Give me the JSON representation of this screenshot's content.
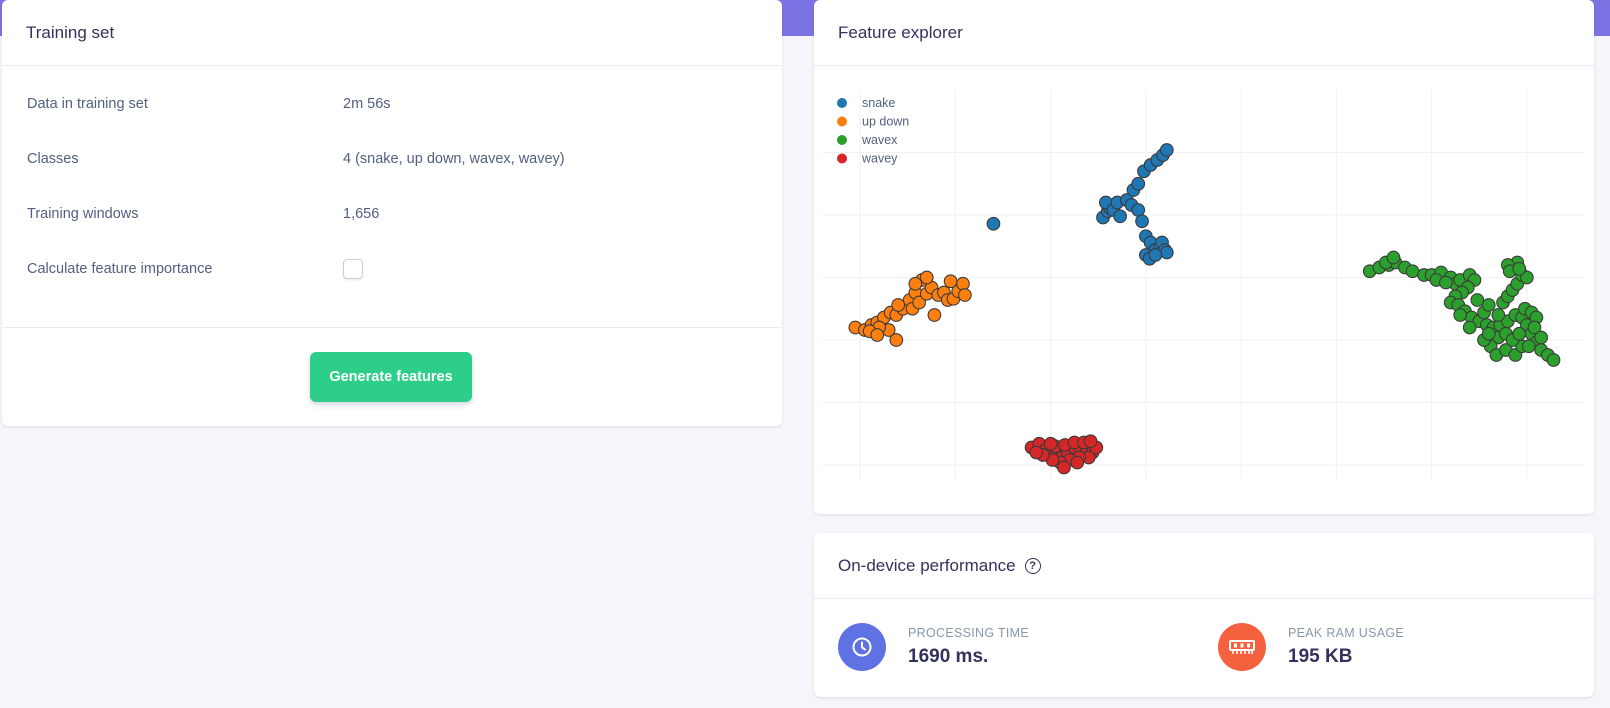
{
  "training_set": {
    "title": "Training set",
    "rows": [
      {
        "label": "Data in training set",
        "value": "2m 56s"
      },
      {
        "label": "Classes",
        "value": "4 (snake, up down, wavex, wavey)"
      },
      {
        "label": "Training windows",
        "value": "1,656"
      },
      {
        "label": "Calculate feature importance",
        "checked": false
      }
    ],
    "generate_button": "Generate features"
  },
  "feature_explorer": {
    "title": "Feature explorer",
    "chart_data": {
      "type": "scatter",
      "title": "",
      "xlabel": "",
      "ylabel": "",
      "legend_position": "top-left",
      "grid": true,
      "series": [
        {
          "name": "snake",
          "color": "#1f77b4",
          "points": [
            [
              1.4,
              0.57
            ],
            [
              2.55,
              0.52
            ],
            [
              2.6,
              0.47
            ],
            [
              2.62,
              0.44
            ],
            [
              2.58,
              0.4
            ],
            [
              2.66,
              0.46
            ],
            [
              2.7,
              0.4
            ],
            [
              2.73,
              0.51
            ],
            [
              2.8,
              0.38
            ],
            [
              2.85,
              0.42
            ],
            [
              2.87,
              0.3
            ],
            [
              2.92,
              0.25
            ],
            [
              2.98,
              0.15
            ],
            [
              3.05,
              0.1
            ],
            [
              3.12,
              0.06
            ],
            [
              3.18,
              0.02
            ],
            [
              3.22,
              -0.02
            ],
            [
              2.92,
              0.46
            ],
            [
              2.96,
              0.55
            ],
            [
              3.0,
              0.67
            ],
            [
              3.05,
              0.72
            ],
            [
              3.1,
              0.78
            ],
            [
              3.15,
              0.76
            ],
            [
              3.17,
              0.72
            ],
            [
              3.2,
              0.78
            ],
            [
              3.22,
              0.8
            ],
            [
              3.0,
              0.82
            ],
            [
              3.04,
              0.85
            ],
            [
              3.1,
              0.82
            ]
          ]
        },
        {
          "name": "up down",
          "color": "#ff7f0e",
          "points": [
            [
              -0.05,
              1.4
            ],
            [
              0.05,
              1.42
            ],
            [
              0.12,
              1.38
            ],
            [
              0.18,
              1.36
            ],
            [
              0.25,
              1.32
            ],
            [
              0.32,
              1.28
            ],
            [
              0.38,
              1.3
            ],
            [
              0.45,
              1.25
            ],
            [
              0.52,
              1.18
            ],
            [
              0.58,
              1.12
            ],
            [
              0.55,
              1.25
            ],
            [
              0.62,
              1.2
            ],
            [
              0.7,
              1.13
            ],
            [
              0.75,
              1.08
            ],
            [
              0.82,
              1.14
            ],
            [
              0.88,
              1.12
            ],
            [
              0.92,
              1.18
            ],
            [
              0.98,
              1.17
            ],
            [
              1.03,
              1.11
            ],
            [
              1.08,
              1.05
            ],
            [
              1.1,
              1.14
            ],
            [
              0.65,
              1.02
            ],
            [
              0.7,
              1.0
            ],
            [
              0.58,
              1.05
            ],
            [
              0.4,
              1.22
            ],
            [
              0.3,
              1.42
            ],
            [
              0.2,
              1.4
            ],
            [
              0.1,
              1.43
            ],
            [
              0.38,
              1.5
            ],
            [
              0.18,
              1.46
            ],
            [
              0.78,
              1.3
            ],
            [
              0.95,
              1.03
            ]
          ]
        },
        {
          "name": "wavex",
          "color": "#2ca02c",
          "points": [
            [
              5.35,
              0.95
            ],
            [
              5.45,
              0.92
            ],
            [
              5.55,
              0.9
            ],
            [
              5.62,
              0.88
            ],
            [
              5.72,
              0.92
            ],
            [
              5.8,
              0.95
            ],
            [
              5.92,
              0.98
            ],
            [
              6.0,
              0.98
            ],
            [
              6.1,
              0.96
            ],
            [
              6.2,
              1.0
            ],
            [
              6.25,
              1.05
            ],
            [
              6.3,
              1.02
            ],
            [
              6.4,
              0.98
            ],
            [
              6.45,
              1.02
            ],
            [
              6.38,
              1.08
            ],
            [
              6.32,
              1.12
            ],
            [
              6.25,
              1.15
            ],
            [
              6.2,
              1.2
            ],
            [
              6.28,
              1.22
            ],
            [
              6.35,
              1.27
            ],
            [
              6.42,
              1.32
            ],
            [
              6.5,
              1.35
            ],
            [
              6.58,
              1.38
            ],
            [
              6.65,
              1.4
            ],
            [
              6.72,
              1.38
            ],
            [
              6.8,
              1.35
            ],
            [
              6.88,
              1.3
            ],
            [
              6.95,
              1.32
            ],
            [
              7.0,
              1.38
            ],
            [
              7.05,
              1.45
            ],
            [
              7.1,
              1.52
            ],
            [
              7.15,
              1.58
            ],
            [
              7.22,
              1.62
            ],
            [
              7.28,
              1.66
            ],
            [
              6.75,
              1.2
            ],
            [
              6.8,
              1.15
            ],
            [
              6.85,
              1.1
            ],
            [
              6.9,
              1.05
            ],
            [
              6.95,
              0.98
            ],
            [
              7.0,
              1.0
            ],
            [
              6.85,
              0.92
            ],
            [
              6.9,
              0.88
            ],
            [
              6.8,
              0.9
            ],
            [
              6.98,
              1.25
            ],
            [
              7.05,
              1.28
            ],
            [
              7.1,
              1.32
            ],
            [
              6.55,
              1.28
            ],
            [
              6.6,
              1.22
            ],
            [
              6.48,
              1.18
            ],
            [
              6.7,
              1.48
            ],
            [
              6.62,
              1.55
            ],
            [
              6.68,
              1.62
            ],
            [
              6.78,
              1.58
            ],
            [
              6.88,
              1.62
            ],
            [
              6.95,
              1.55
            ],
            [
              6.3,
              1.3
            ],
            [
              6.4,
              1.4
            ],
            [
              6.55,
              1.5
            ],
            [
              6.6,
              1.45
            ],
            [
              6.7,
              1.3
            ],
            [
              6.78,
              1.45
            ],
            [
              6.85,
              1.5
            ],
            [
              6.92,
              1.45
            ],
            [
              7.02,
              1.55
            ],
            [
              5.52,
              0.88
            ],
            [
              5.6,
              0.84
            ],
            [
              6.05,
              1.02
            ],
            [
              6.15,
              1.04
            ],
            [
              6.82,
              0.95
            ],
            [
              6.92,
              0.93
            ],
            [
              7.08,
              1.4
            ],
            [
              7.15,
              1.48
            ]
          ]
        },
        {
          "name": "wavey",
          "color": "#d62728",
          "points": [
            [
              1.8,
              2.36
            ],
            [
              1.88,
              2.33
            ],
            [
              1.95,
              2.38
            ],
            [
              2.0,
              2.42
            ],
            [
              2.06,
              2.4
            ],
            [
              2.12,
              2.44
            ],
            [
              2.18,
              2.4
            ],
            [
              2.25,
              2.36
            ],
            [
              2.32,
              2.38
            ],
            [
              2.38,
              2.36
            ],
            [
              2.44,
              2.4
            ],
            [
              2.48,
              2.36
            ],
            [
              2.4,
              2.44
            ],
            [
              2.3,
              2.44
            ],
            [
              2.2,
              2.46
            ],
            [
              2.1,
              2.48
            ],
            [
              2.02,
              2.46
            ],
            [
              1.92,
              2.42
            ],
            [
              1.85,
              2.4
            ],
            [
              2.05,
              2.35
            ],
            [
              2.15,
              2.34
            ],
            [
              2.25,
              2.32
            ],
            [
              2.35,
              2.32
            ],
            [
              2.42,
              2.31
            ],
            [
              2.0,
              2.33
            ],
            [
              2.28,
              2.48
            ],
            [
              2.14,
              2.52
            ]
          ]
        }
      ]
    }
  },
  "performance": {
    "title": "On-device performance",
    "help_icon": "question-circle-icon",
    "metrics": [
      {
        "label": "PROCESSING TIME",
        "value": "1690 ms.",
        "icon": "clock-icon",
        "color": "#5e72e4"
      },
      {
        "label": "PEAK RAM USAGE",
        "value": "195 KB",
        "icon": "memory-chip-icon",
        "color": "#f5603e"
      }
    ]
  }
}
